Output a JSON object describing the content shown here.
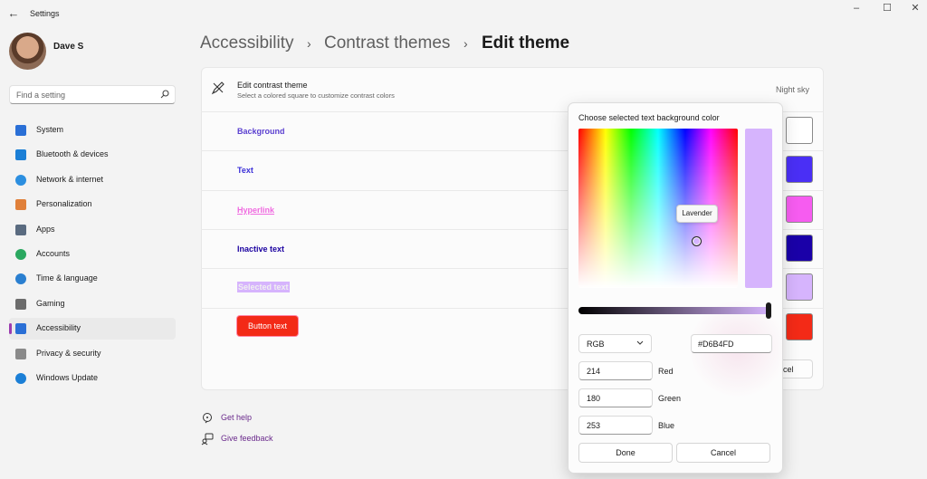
{
  "app": {
    "title": "Settings"
  },
  "profile": {
    "name": "Dave S"
  },
  "search": {
    "placeholder": "Find a setting"
  },
  "nav": {
    "items": [
      {
        "label": "System",
        "icon": "monitor-icon",
        "color": "#2a6fd6"
      },
      {
        "label": "Bluetooth & devices",
        "icon": "bluetooth-icon",
        "color": "#1b7fd6"
      },
      {
        "label": "Network & internet",
        "icon": "wifi-icon",
        "color": "#2c8fe0"
      },
      {
        "label": "Personalization",
        "icon": "brush-icon",
        "color": "#e0803a"
      },
      {
        "label": "Apps",
        "icon": "apps-icon",
        "color": "#5a6b80"
      },
      {
        "label": "Accounts",
        "icon": "person-icon",
        "color": "#2ba860"
      },
      {
        "label": "Time & language",
        "icon": "globe-clock-icon",
        "color": "#2a7fd0"
      },
      {
        "label": "Gaming",
        "icon": "controller-icon",
        "color": "#6c6c6c"
      },
      {
        "label": "Accessibility",
        "icon": "accessibility-icon",
        "color": "#2a6fd6"
      },
      {
        "label": "Privacy & security",
        "icon": "shield-icon",
        "color": "#8a8a8a"
      },
      {
        "label": "Windows Update",
        "icon": "update-icon",
        "color": "#1b7fd6"
      }
    ],
    "active_index": 8
  },
  "breadcrumb": {
    "items": [
      "Accessibility",
      "Contrast themes",
      "Edit theme"
    ]
  },
  "editor": {
    "title": "Edit contrast theme",
    "subtitle": "Select a colored square to customize contrast colors",
    "theme_name": "Night sky",
    "rows": [
      {
        "label": "Background",
        "color": "#5a3fd0",
        "swatch": "#ffffff"
      },
      {
        "label": "Text",
        "color": "#3a2fd8",
        "swatch": "#4a2ff5"
      },
      {
        "label": "Hyperlink",
        "color": "#f06ae0",
        "swatch": "#f65cf0"
      },
      {
        "label": "Inactive text",
        "color": "#1a00a0",
        "swatch": "#1a00a8"
      },
      {
        "label": "Selected text",
        "color": "#f0f0f0",
        "swatch": "#d6b4fd"
      },
      {
        "label": "Button text",
        "color": "#ffffff",
        "swatch": "#f32a17"
      }
    ],
    "cancel_label": "ncel"
  },
  "help": {
    "get_help": "Get help",
    "feedback": "Give feedback"
  },
  "color_dialog": {
    "title": "Choose selected text background color",
    "tooltip": "Lavender",
    "preview_color": "#d6b4fd",
    "mode": "RGB",
    "hex": "#D6B4FD",
    "red": {
      "label": "Red",
      "value": "214"
    },
    "green": {
      "label": "Green",
      "value": "180"
    },
    "blue": {
      "label": "Blue",
      "value": "253"
    },
    "done_label": "Done",
    "cancel_label": "Cancel"
  }
}
